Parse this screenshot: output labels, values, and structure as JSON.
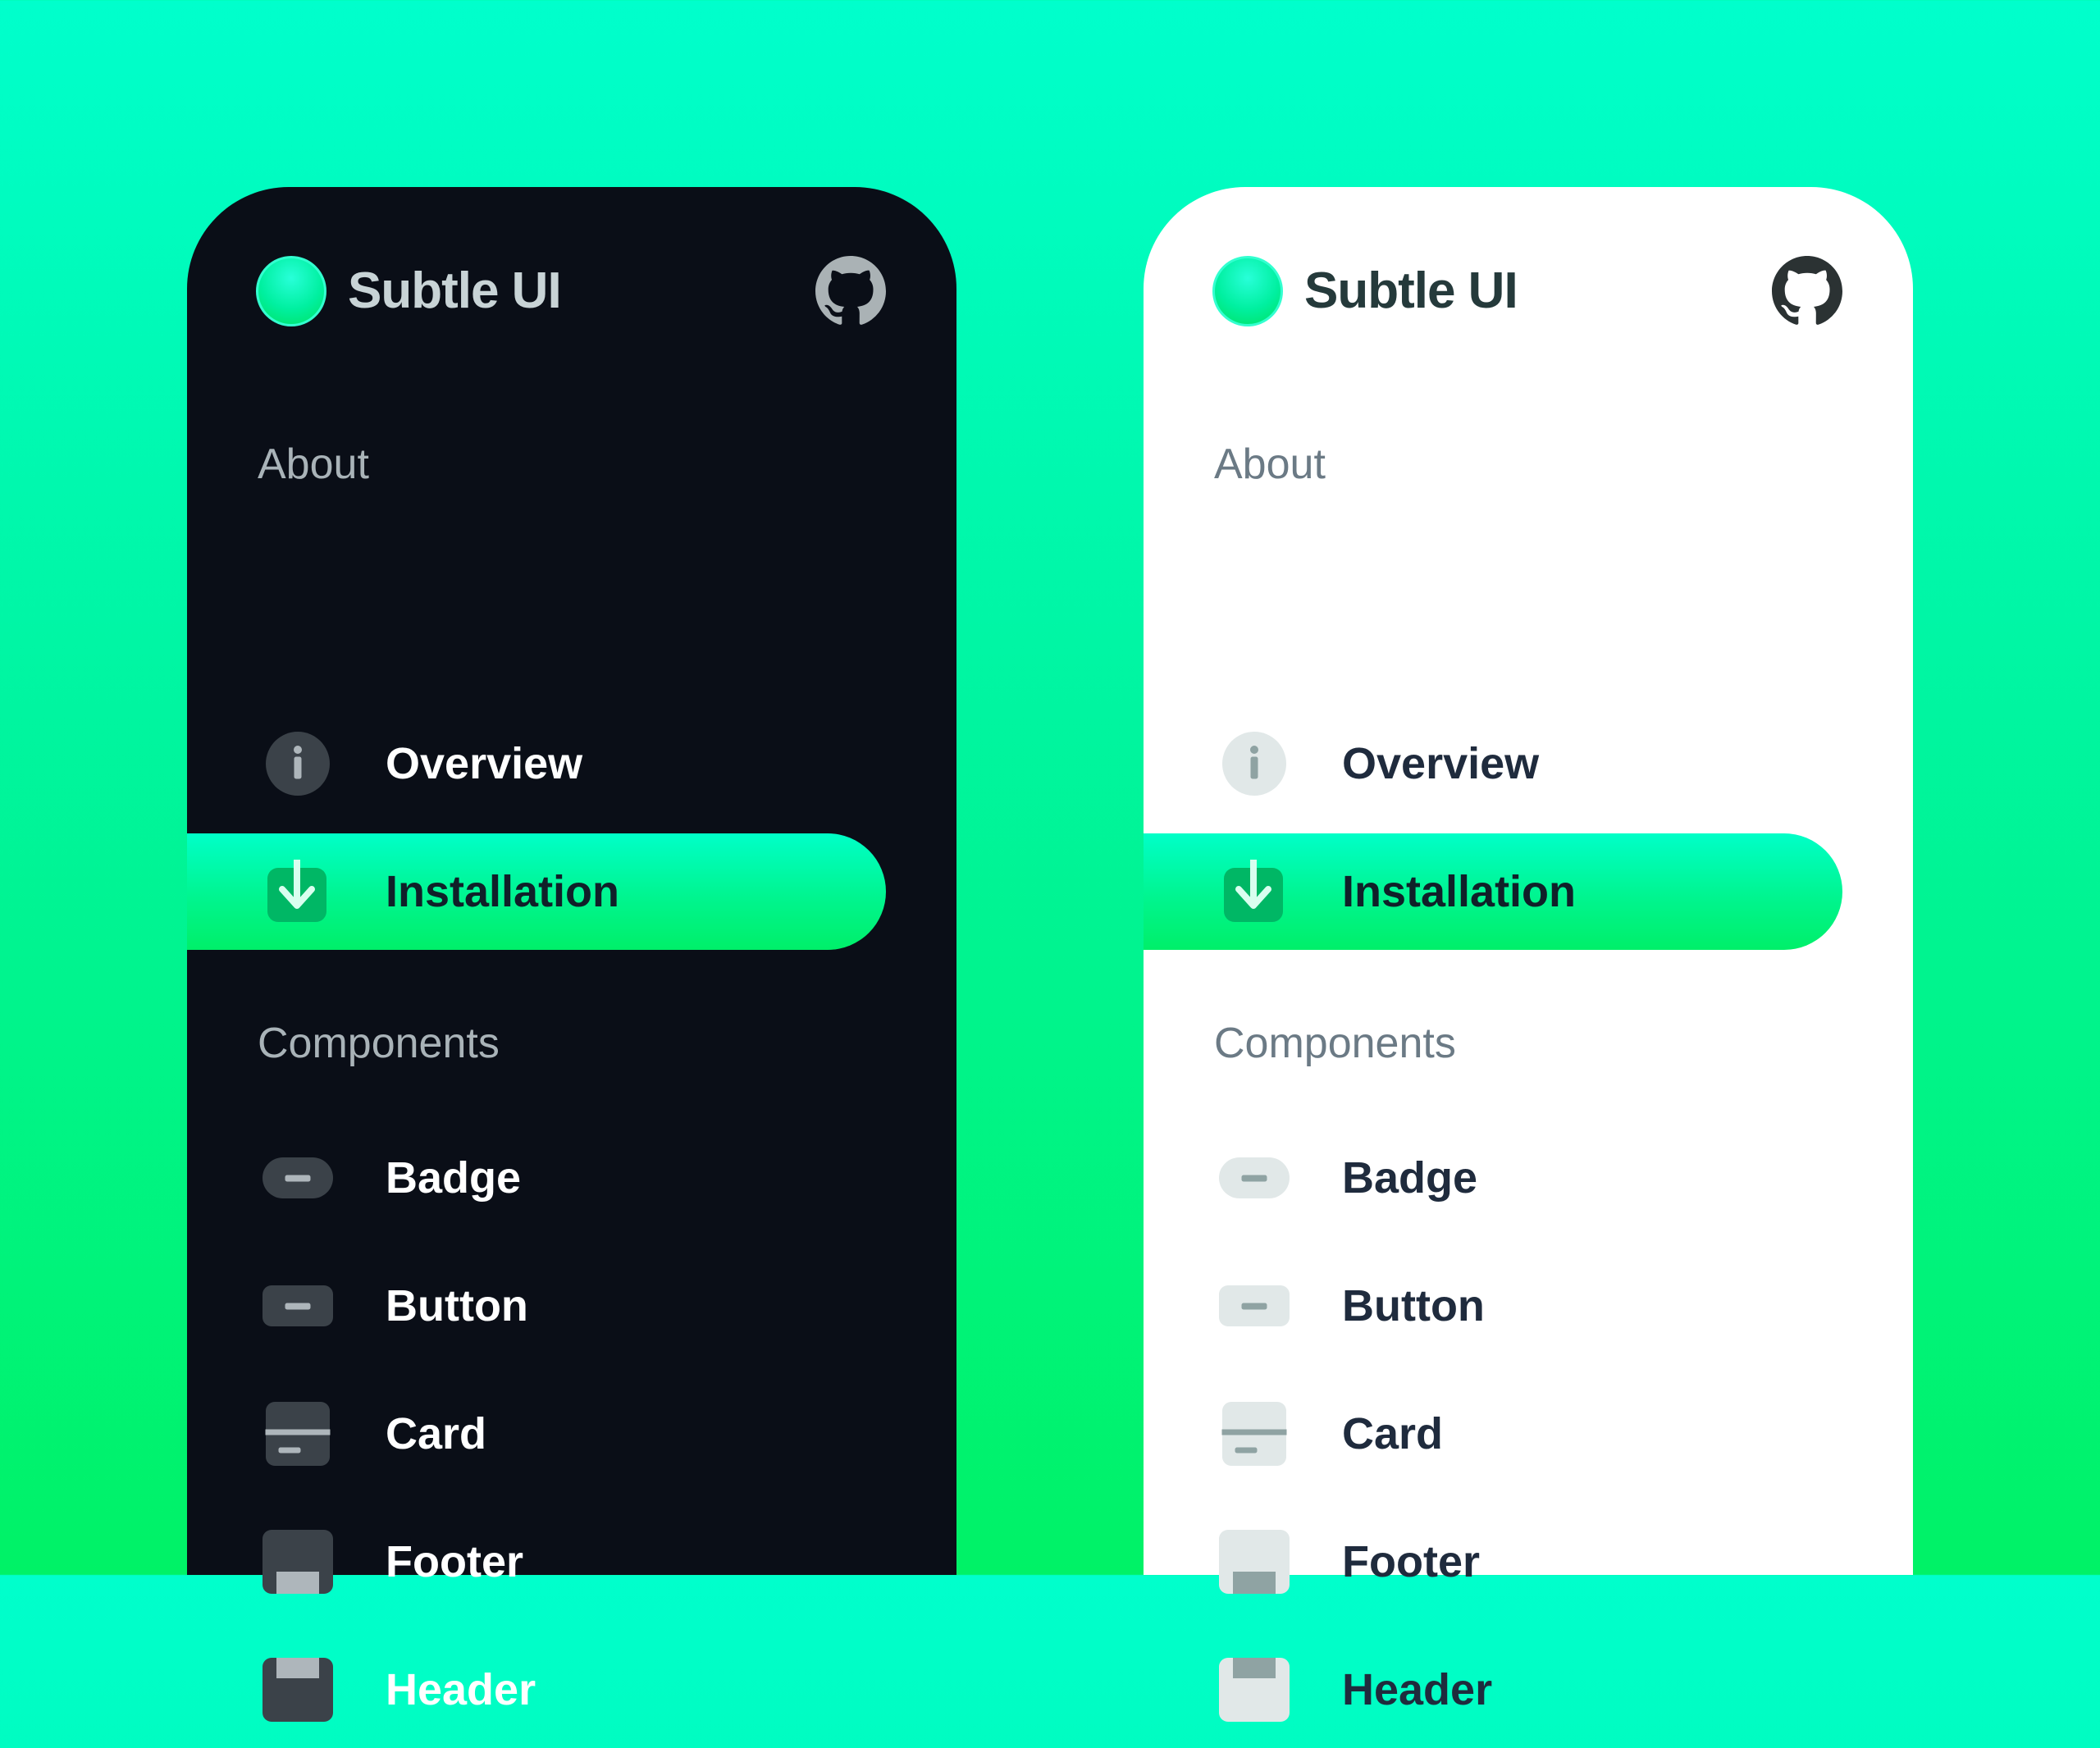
{
  "brand": {
    "name": "Subtle UI",
    "accent": "#00f5a0"
  },
  "icons": {
    "logo": "logo-dot",
    "github": "github-icon",
    "overview": "info-icon",
    "installation": "download-icon",
    "badge": "badge-icon",
    "button": "button-icon",
    "card": "card-icon",
    "footer": "footer-icon",
    "header": "header-icon"
  },
  "sections": {
    "about": {
      "title": "About",
      "items": [
        {
          "label": "Overview",
          "active": false
        },
        {
          "label": "Installation",
          "active": true
        }
      ]
    },
    "components": {
      "title": "Components",
      "items": [
        {
          "label": "Badge"
        },
        {
          "label": "Button"
        },
        {
          "label": "Card"
        },
        {
          "label": "Footer"
        },
        {
          "label": "Header"
        }
      ]
    }
  },
  "themes": {
    "dark": {
      "panel_bg": "#0a0e17",
      "text": "#ffffff",
      "muted": "#a9b3b8"
    },
    "light": {
      "panel_bg": "#ffffff",
      "text": "#1f2b3d",
      "muted": "#6b7a85"
    }
  }
}
